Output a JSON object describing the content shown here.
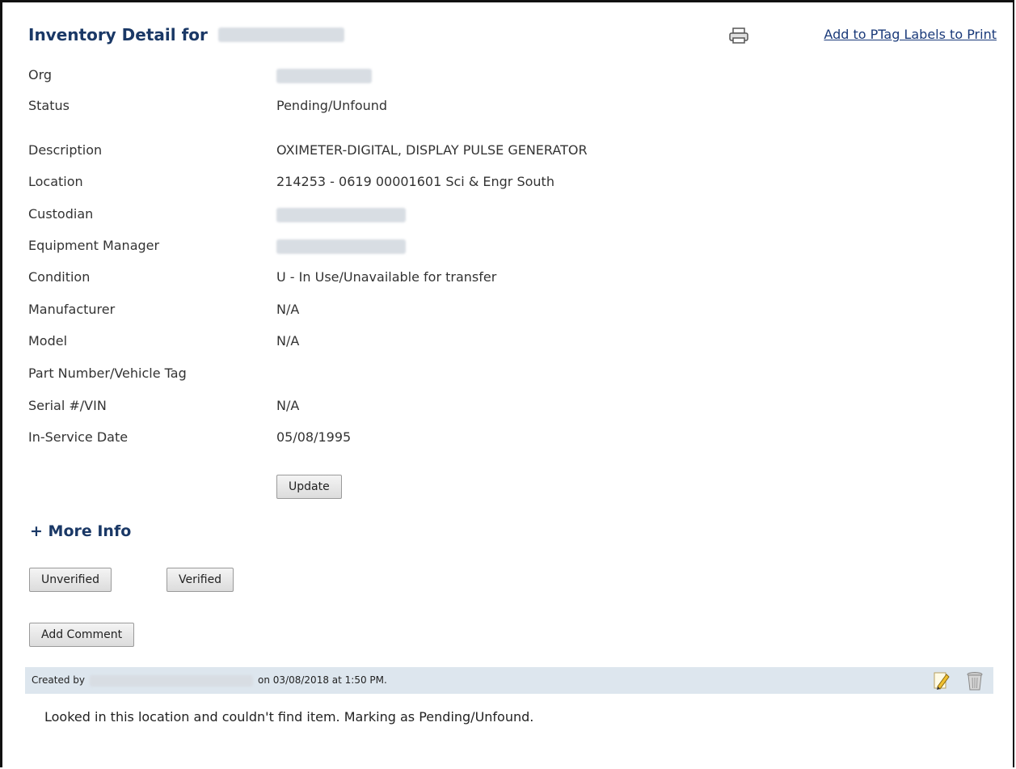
{
  "header": {
    "title": "Inventory Detail for",
    "print_link": "Add to PTag Labels to Print"
  },
  "fields": [
    {
      "label": "Org",
      "value": ""
    },
    {
      "label": "Status",
      "value": "Pending/Unfound"
    },
    {
      "label": "Description",
      "value": "OXIMETER-DIGITAL, DISPLAY PULSE GENERATOR"
    },
    {
      "label": "Location",
      "value": "214253 - 0619 00001601 Sci & Engr South"
    },
    {
      "label": "Custodian",
      "value": ""
    },
    {
      "label": "Equipment Manager",
      "value": ""
    },
    {
      "label": "Condition",
      "value": "U - In Use/Unavailable for transfer"
    },
    {
      "label": "Manufacturer",
      "value": "N/A"
    },
    {
      "label": "Model",
      "value": "N/A"
    },
    {
      "label": "Part Number/Vehicle Tag",
      "value": ""
    },
    {
      "label": "Serial #/VIN",
      "value": "N/A"
    },
    {
      "label": "In-Service Date",
      "value": "05/08/1995"
    }
  ],
  "buttons": {
    "update": "Update",
    "unverified": "Unverified",
    "verified": "Verified",
    "add_comment": "Add Comment"
  },
  "more_info": "+ More Info",
  "comment": {
    "created_by_prefix": "Created by",
    "created_on": "on 03/08/2018 at 1:50 PM.",
    "text": "Looked in this location and couldn't find item. Marking as Pending/Unfound."
  },
  "icons": {
    "print": "printer-icon",
    "edit": "pencil-icon",
    "delete": "trash-icon"
  }
}
